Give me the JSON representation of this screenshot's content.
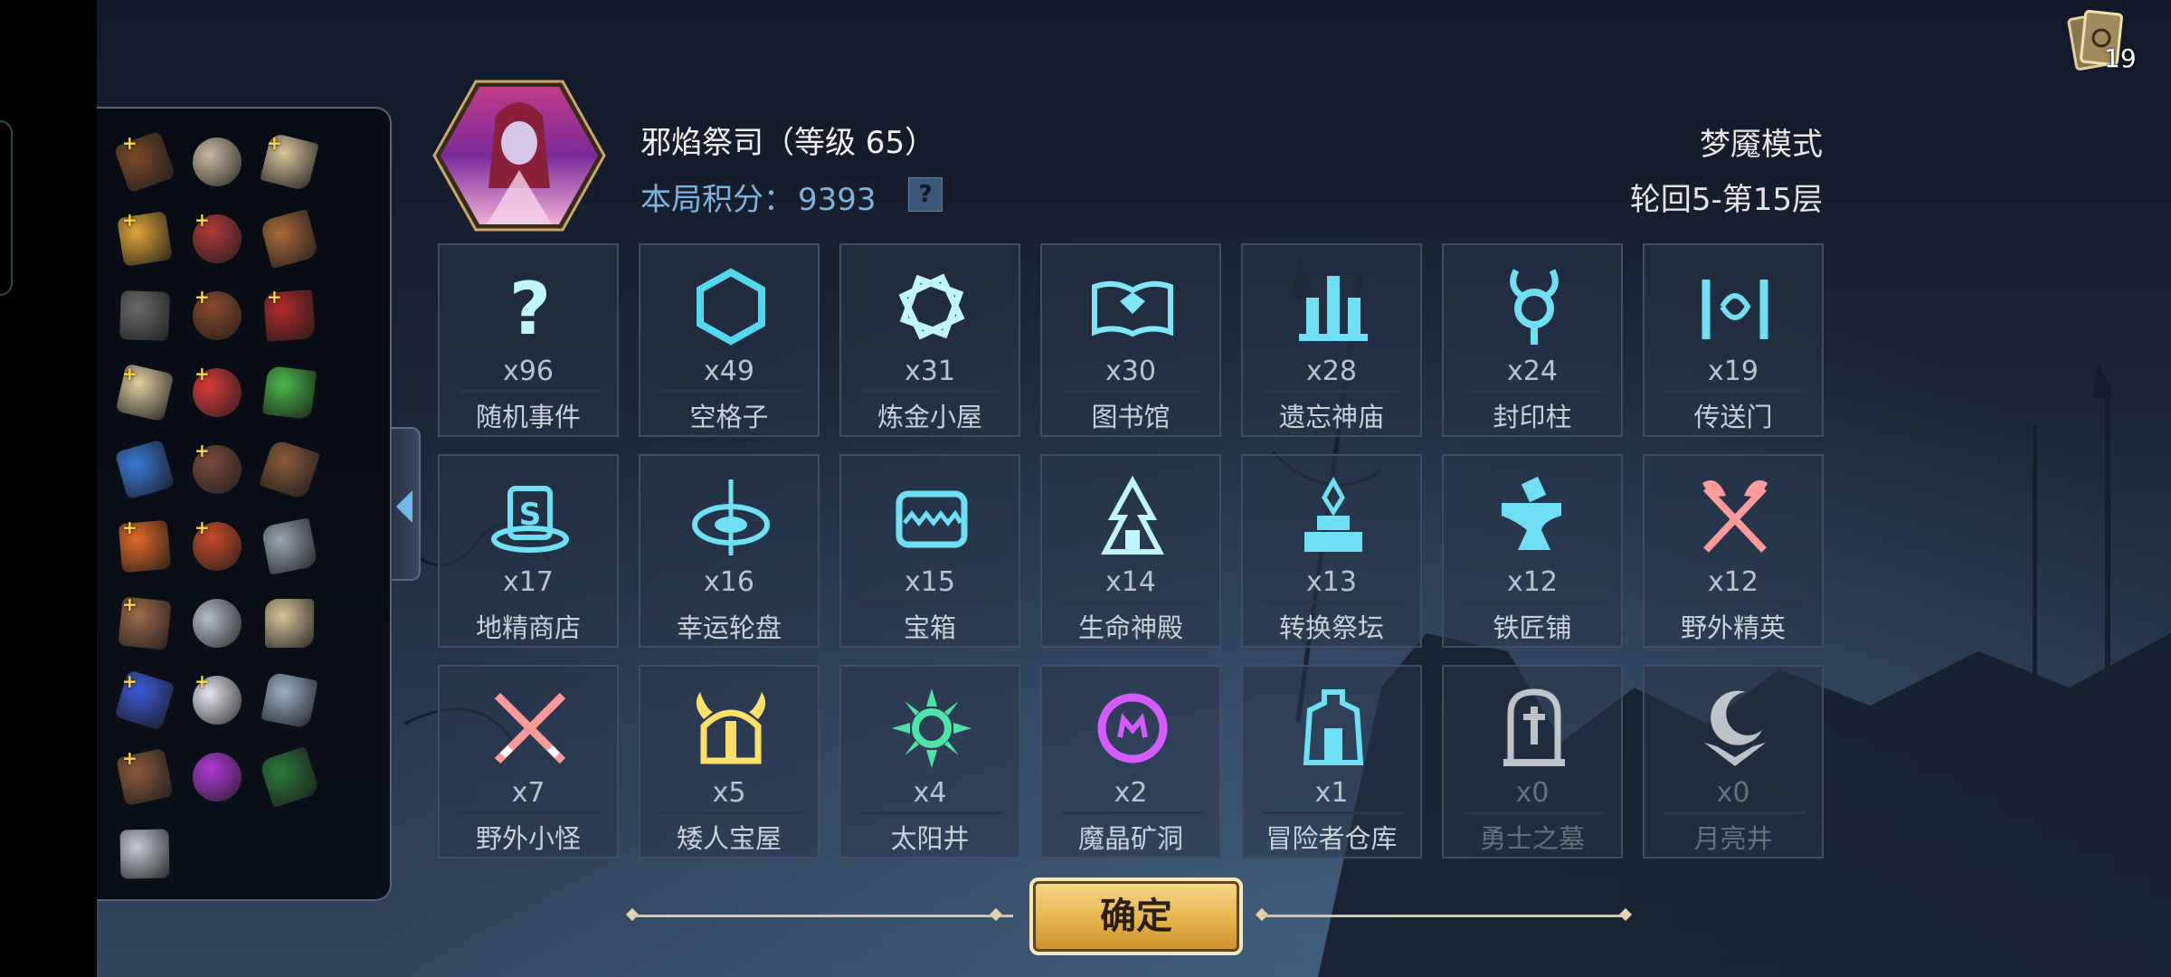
{
  "character": {
    "name": "邪焰祭司（等级 65）",
    "score_label": "本局积分：",
    "score_value": "9393",
    "help_icon": "?"
  },
  "mode": {
    "label": "梦魇模式",
    "progress": "轮回5-第15层"
  },
  "deck": {
    "count": "19",
    "icon": "card-deck-icon"
  },
  "inventory": {
    "items": [
      {
        "icon": "scroll-map-icon",
        "plus": true
      },
      {
        "icon": "skull-horn-icon",
        "plus": false
      },
      {
        "icon": "parchment-icon",
        "plus": true
      },
      {
        "icon": "golden-gauntlet-icon",
        "plus": true
      },
      {
        "icon": "spellbook-red-icon",
        "plus": true
      },
      {
        "icon": "scroll-red-icon",
        "plus": false
      },
      {
        "icon": "stone-helmet-icon",
        "plus": false
      },
      {
        "icon": "tome-icon",
        "plus": true
      },
      {
        "icon": "red-bag-icon",
        "plus": true
      },
      {
        "icon": "cloth-scroll-icon",
        "plus": true
      },
      {
        "icon": "red-potion-icon",
        "plus": true
      },
      {
        "icon": "green-potion-icon",
        "plus": false
      },
      {
        "icon": "magnifier-icon",
        "plus": false
      },
      {
        "icon": "book-quill-icon",
        "plus": true
      },
      {
        "icon": "leather-belt-icon",
        "plus": false
      },
      {
        "icon": "fire-shell-icon",
        "plus": true
      },
      {
        "icon": "fire-torch-icon",
        "plus": true
      },
      {
        "icon": "hammer-icon",
        "plus": false
      },
      {
        "icon": "clay-jar-icon",
        "plus": true
      },
      {
        "icon": "rune-tablet-icon",
        "plus": false
      },
      {
        "icon": "old-scroll-icon",
        "plus": false
      },
      {
        "icon": "blue-gem-icon",
        "plus": true
      },
      {
        "icon": "white-feather-icon",
        "plus": true
      },
      {
        "icon": "card-icon",
        "plus": false
      },
      {
        "icon": "skull-barrel-icon",
        "plus": true
      },
      {
        "icon": "purple-grapes-icon",
        "plus": false
      },
      {
        "icon": "green-gem-book-icon",
        "plus": false
      },
      {
        "icon": "amulet-icon",
        "plus": false
      }
    ]
  },
  "events": [
    {
      "count": "x96",
      "label": "随机事件",
      "icon": "question-icon",
      "color": "#bff6ff"
    },
    {
      "count": "x49",
      "label": "空格子",
      "icon": "hexagon-icon",
      "color": "#56d7f0"
    },
    {
      "count": "x31",
      "label": "炼金小屋",
      "icon": "alchemy-knot-icon",
      "color": "#bff6ff"
    },
    {
      "count": "x30",
      "label": "图书馆",
      "icon": "open-book-icon",
      "color": "#7fe6f7"
    },
    {
      "count": "x28",
      "label": "遗忘神庙",
      "icon": "temple-icon",
      "color": "#6fe0f4"
    },
    {
      "count": "x24",
      "label": "封印柱",
      "icon": "seal-pillar-icon",
      "color": "#6fe0f4"
    },
    {
      "count": "x19",
      "label": "传送门",
      "icon": "portal-icon",
      "color": "#6fe0f4"
    },
    {
      "count": "x17",
      "label": "地精商店",
      "icon": "goblin-shop-icon",
      "color": "#6fe0f4"
    },
    {
      "count": "x16",
      "label": "幸运轮盘",
      "icon": "lucky-wheel-icon",
      "color": "#6fe0f4"
    },
    {
      "count": "x15",
      "label": "宝箱",
      "icon": "mimic-chest-icon",
      "color": "#6fe0f4"
    },
    {
      "count": "x14",
      "label": "生命神殿",
      "icon": "life-shrine-icon",
      "color": "#bff6ff"
    },
    {
      "count": "x13",
      "label": "转换祭坛",
      "icon": "altar-icon",
      "color": "#6fe0f4"
    },
    {
      "count": "x12",
      "label": "铁匠铺",
      "icon": "anvil-icon",
      "color": "#6fe0f4"
    },
    {
      "count": "x12",
      "label": "野外精英",
      "icon": "crossed-axes-icon",
      "color": "#ff9a9a"
    },
    {
      "count": "x7",
      "label": "野外小怪",
      "icon": "crossed-swords-icon",
      "color": "#ff9a9a"
    },
    {
      "count": "x5",
      "label": "矮人宝屋",
      "icon": "dwarf-helmet-icon",
      "color": "#ffe066"
    },
    {
      "count": "x4",
      "label": "太阳井",
      "icon": "sun-well-icon",
      "color": "#4fe3a8"
    },
    {
      "count": "x2",
      "label": "魔晶矿洞",
      "icon": "crystal-mine-icon",
      "color": "#d45cff"
    },
    {
      "count": "x1",
      "label": "冒险者仓库",
      "icon": "warehouse-icon",
      "color": "#6fe0f4"
    },
    {
      "count": "x0",
      "label": "勇士之墓",
      "icon": "tombstone-icon",
      "color": "#d9dde2",
      "zero": true
    },
    {
      "count": "x0",
      "label": "月亮井",
      "icon": "moon-well-icon",
      "color": "#d9dde2",
      "zero": true
    }
  ],
  "confirm": {
    "label": "确定"
  }
}
